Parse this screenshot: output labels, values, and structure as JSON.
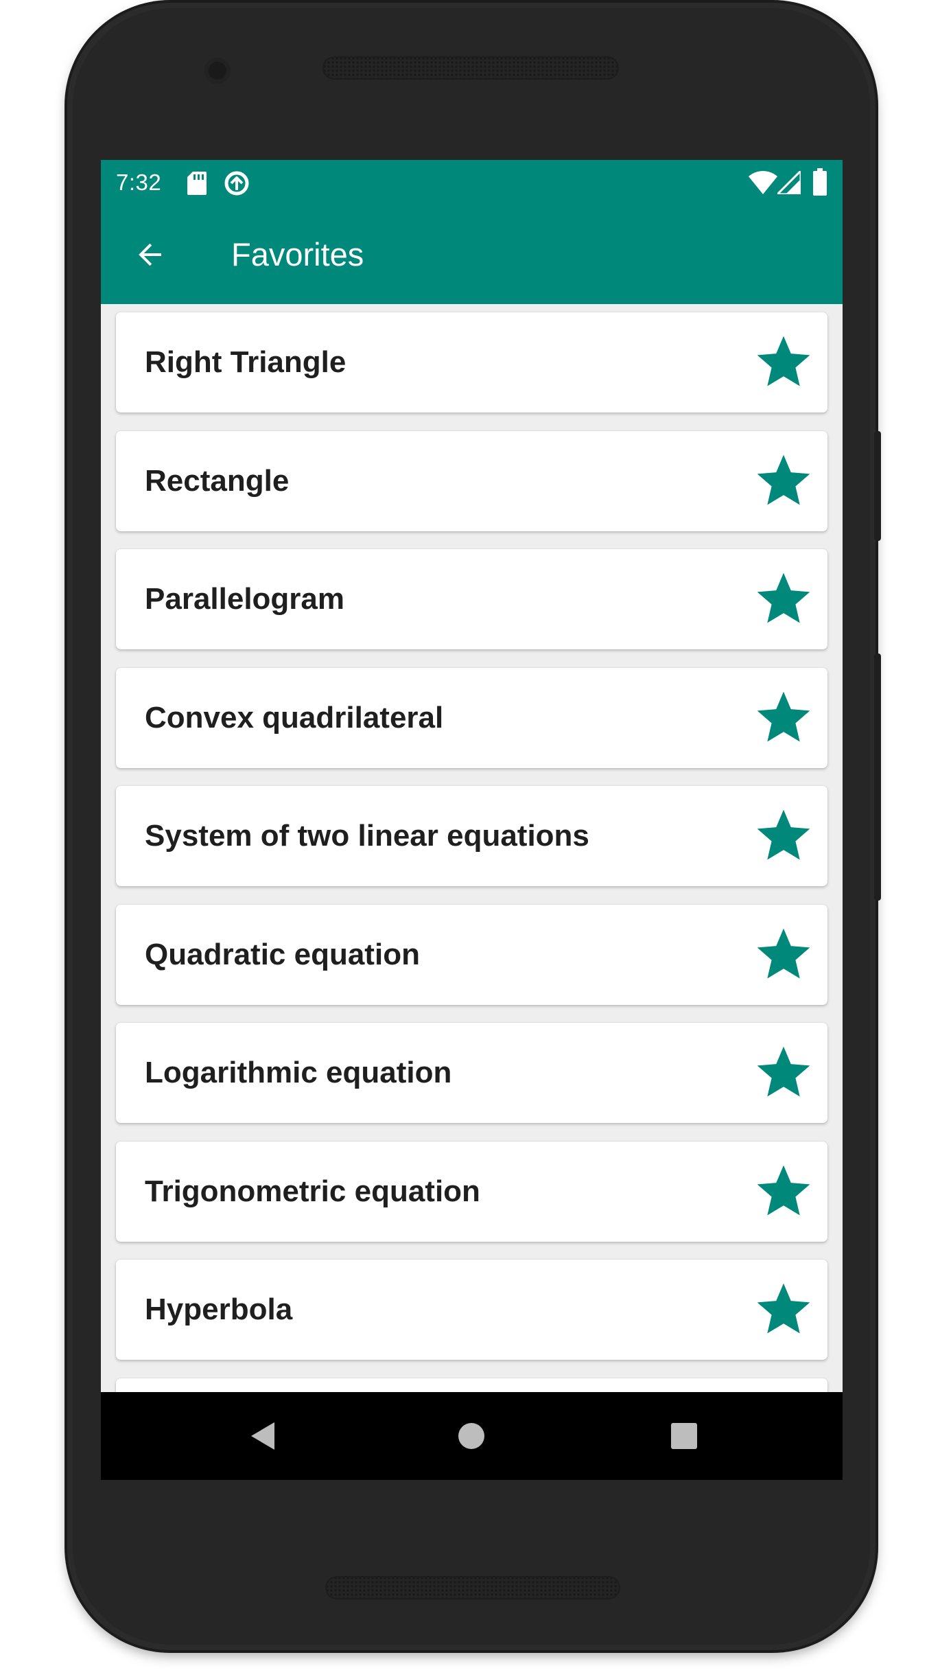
{
  "status_bar": {
    "time": "7:32",
    "icons": [
      "sd-card-icon",
      "sync-icon",
      "wifi-icon",
      "cell-signal-icon",
      "battery-icon"
    ]
  },
  "app_bar": {
    "title": "Favorites",
    "back_icon": "arrow-back-icon",
    "background_color": "#00897b"
  },
  "favorites": {
    "star_icon": "star-filled-icon",
    "star_color": "#00897b",
    "items": [
      {
        "label": "Right Triangle",
        "favorited": true
      },
      {
        "label": "Rectangle",
        "favorited": true
      },
      {
        "label": "Parallelogram",
        "favorited": true
      },
      {
        "label": "Convex quadrilateral",
        "favorited": true
      },
      {
        "label": "System of two linear equations",
        "favorited": true
      },
      {
        "label": "Quadratic equation",
        "favorited": true
      },
      {
        "label": "Logarithmic equation",
        "favorited": true
      },
      {
        "label": "Trigonometric equation",
        "favorited": true
      },
      {
        "label": "Hyperbola",
        "favorited": true
      }
    ]
  },
  "nav_bar": {
    "icons": [
      "back-triangle-icon",
      "home-circle-icon",
      "recents-square-icon"
    ]
  }
}
